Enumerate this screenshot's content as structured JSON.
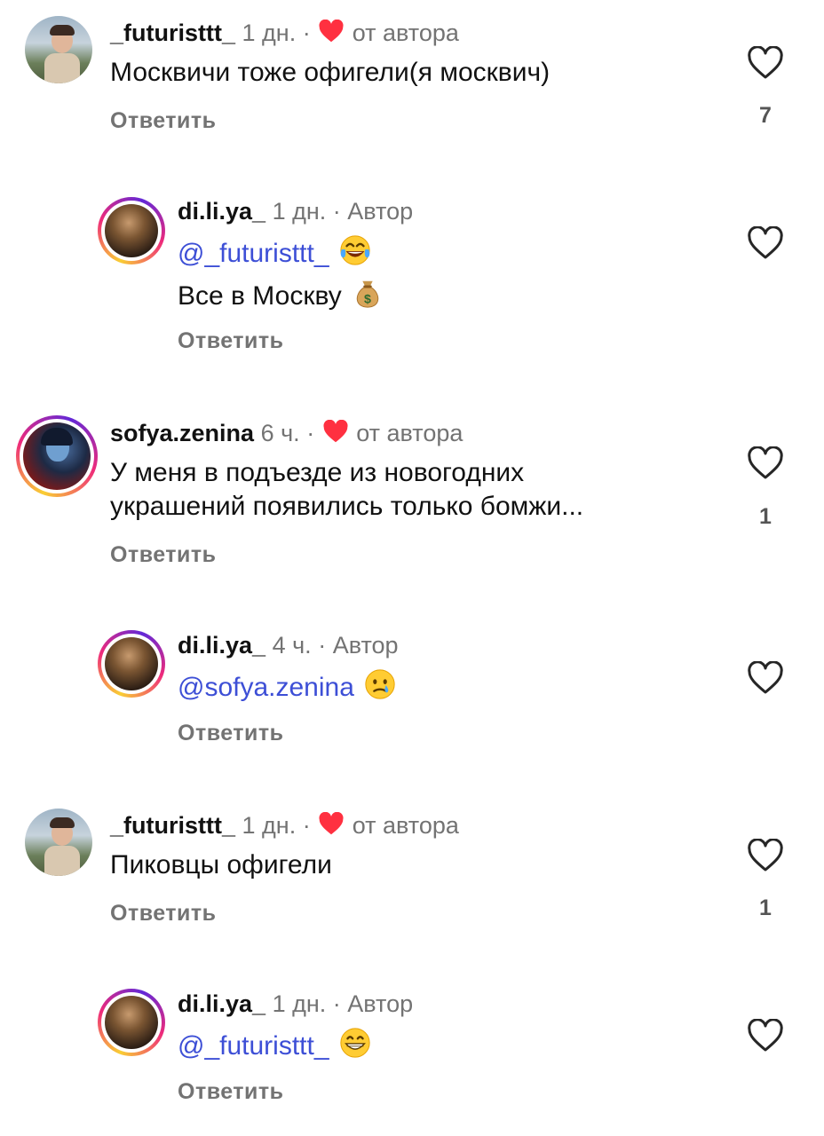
{
  "reply_label": "Ответить",
  "author_liked_label": "от автора",
  "author_tag": "Автор",
  "separator": "·",
  "comments": [
    {
      "username": "_futuristtt_",
      "time": "1 дн.",
      "text": "Москвичи тоже офигели(я москвич)",
      "likes": "7"
    },
    {
      "username": "di.li.ya_",
      "time": "1 дн.",
      "mention": "@_futuristtt_",
      "emoji": "laughing-tears-emoji",
      "text": "Все в Москву",
      "text_emoji": "money-bag-emoji"
    },
    {
      "username": "sofya.zenina",
      "time": "6 ч.",
      "text_line1": "У меня в подъезде из новогодних",
      "text_line2": "украшений появились только бомжи...",
      "likes": "1"
    },
    {
      "username": "di.li.ya_",
      "time": "4 ч.",
      "mention": "@sofya.zenina",
      "emoji": "crying-emoji"
    },
    {
      "username": "_futuristtt_",
      "time": "1 дн.",
      "text": "Пиковцы офигели",
      "likes": "1"
    },
    {
      "username": "di.li.ya_",
      "time": "1 дн.",
      "mention": "@_futuristtt_",
      "emoji": "grinning-emoji"
    }
  ],
  "colors": {
    "mention": "#3d4fd6",
    "heart_red": "#ff3040",
    "muted": "#737373"
  }
}
